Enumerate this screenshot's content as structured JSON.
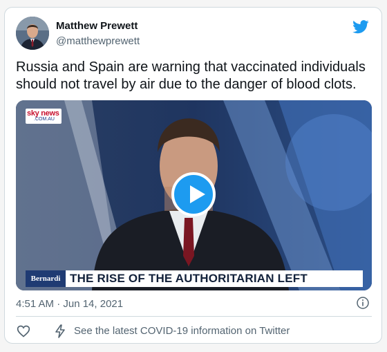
{
  "author": {
    "name": "Matthew Prewett",
    "handle": "@matthewprewett"
  },
  "tweet": {
    "text": "Russia and Spain are warning that vaccinated individuals should not travel by air due to the danger of blood clots.",
    "timestamp": "4:51 AM · Jun 14, 2021"
  },
  "video": {
    "logo_main": "sky news",
    "logo_sub": ".COM.AU",
    "lower_third_logo": "Bernardi",
    "lower_third_text": "THE RISE OF THE AUTHORITARIAN LEFT"
  },
  "footer": {
    "covid_link": "See the latest COVID-19 information on Twitter"
  },
  "icons": {
    "brand": "twitter-bird-icon",
    "like": "heart-icon",
    "covid": "lightning-bolt-icon",
    "info": "info-icon",
    "play": "play-icon"
  },
  "colors": {
    "accent": "#1d9bf0",
    "text_primary": "#0f1419",
    "text_secondary": "#536471",
    "border": "#cfd9de"
  }
}
